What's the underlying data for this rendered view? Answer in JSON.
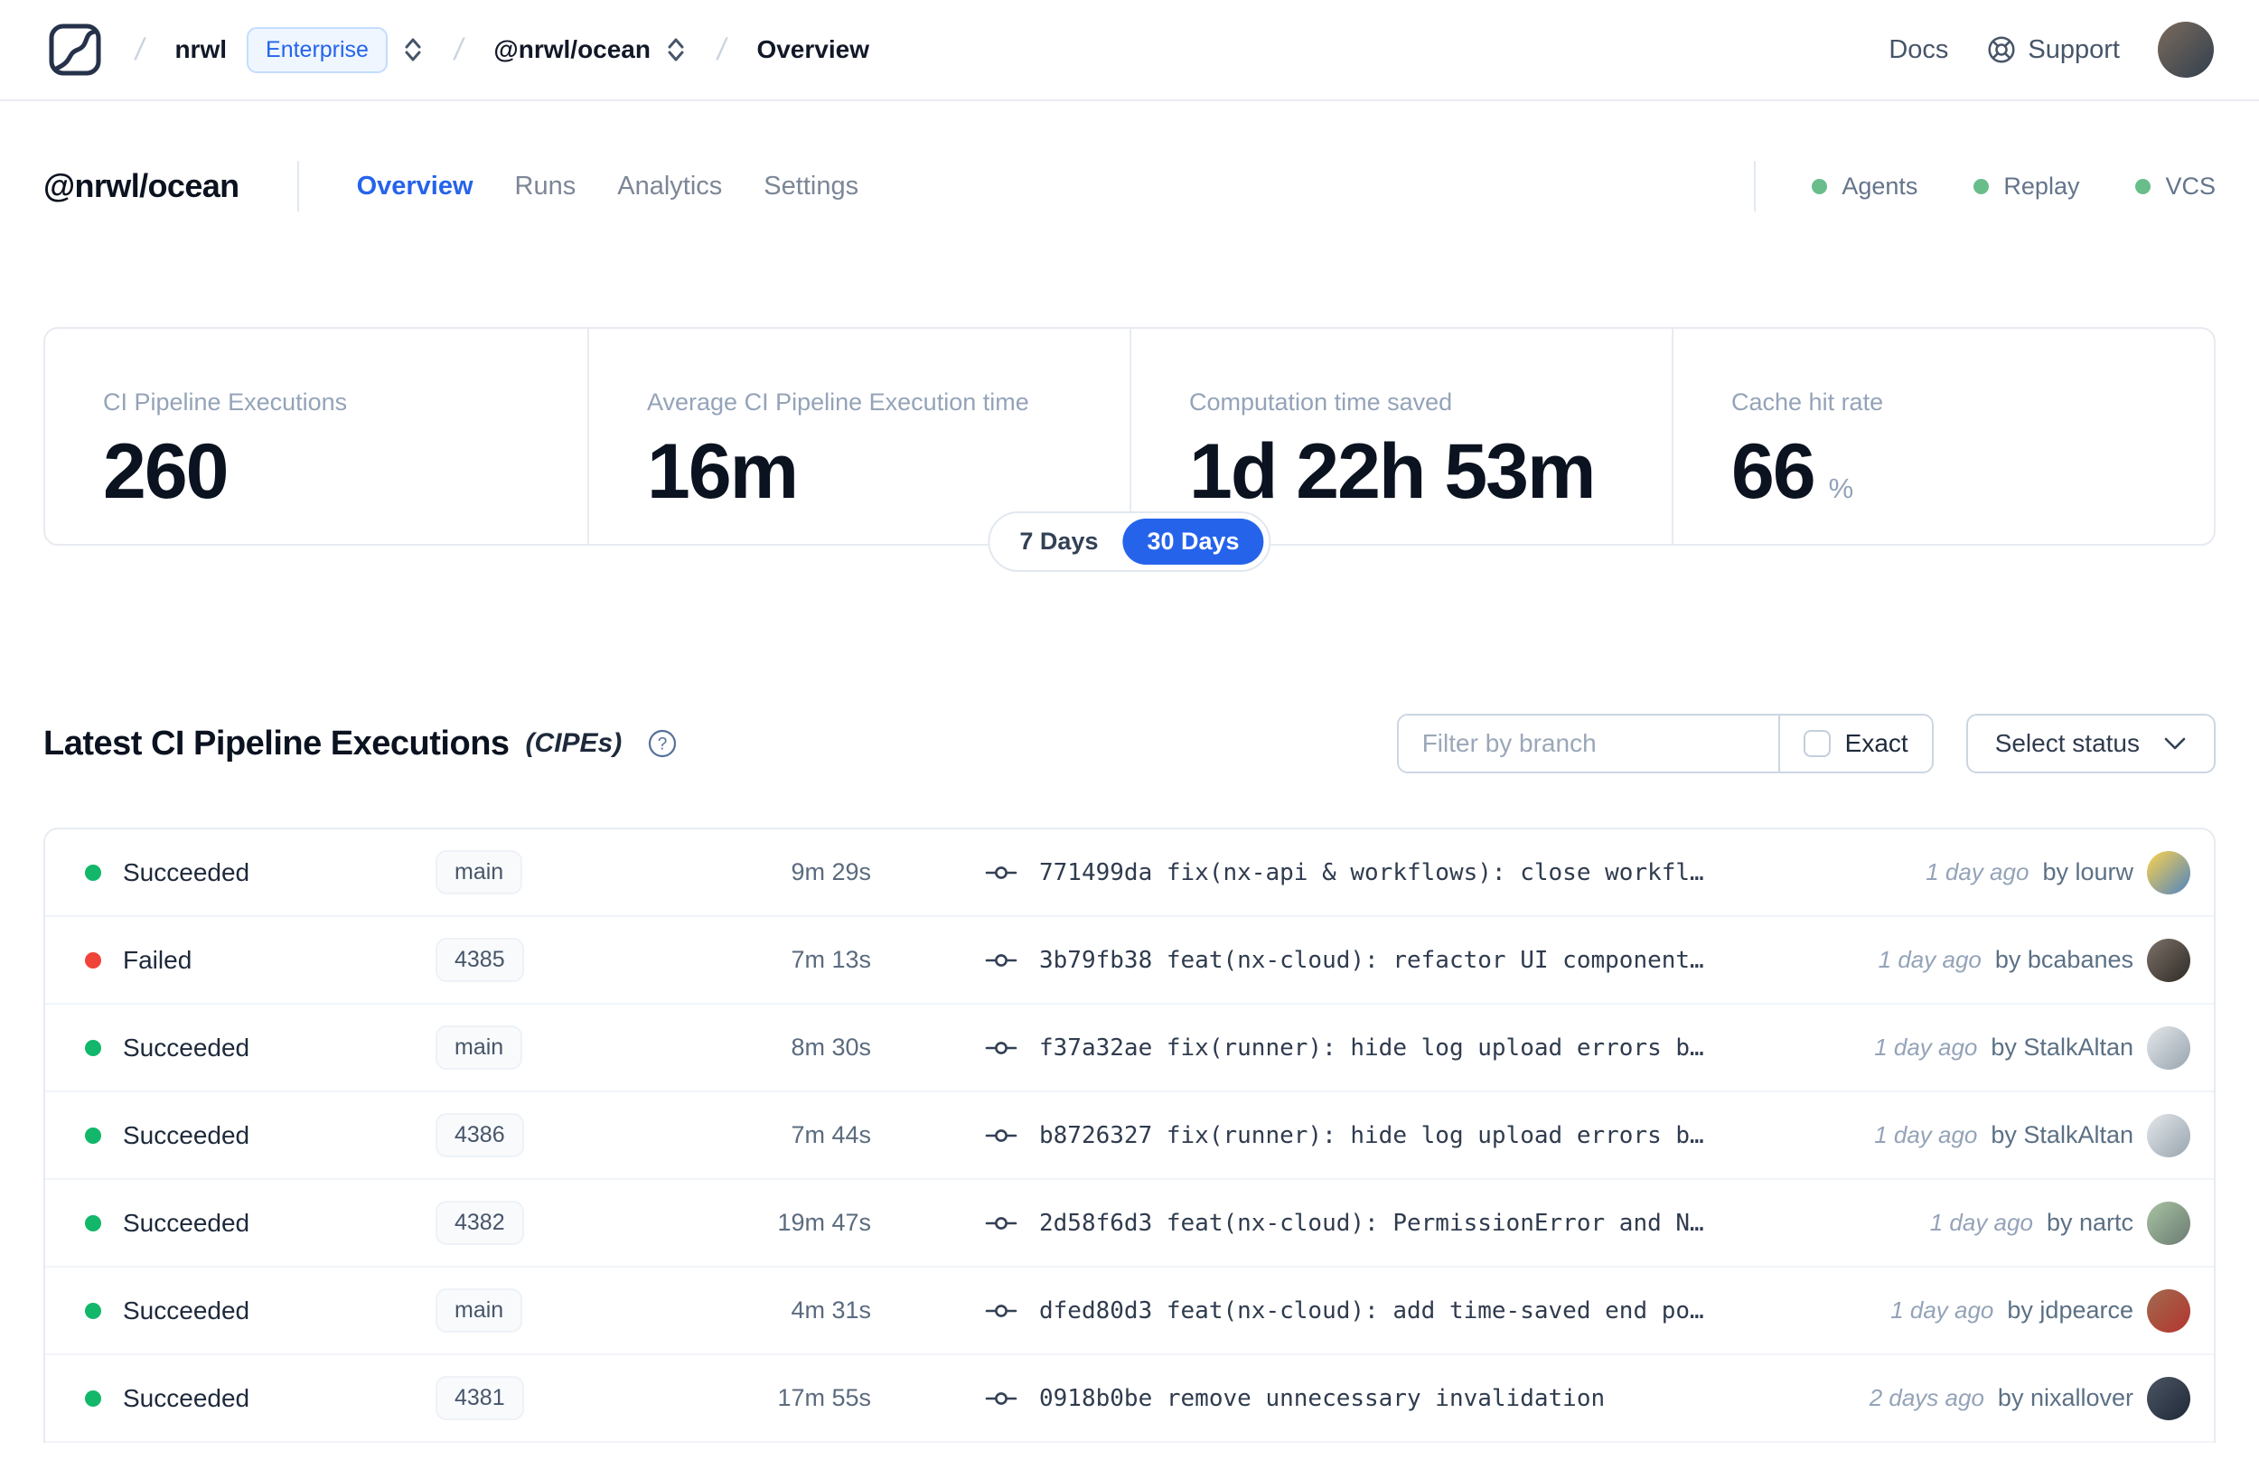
{
  "colors": {
    "accent": "#2563eb",
    "succeeded": "#12b76a",
    "failed": "#f04438",
    "feature_green": "#68bd8b"
  },
  "header": {
    "separator": "/",
    "org": "nrwl",
    "plan_badge": "Enterprise",
    "workspace": "@nrwl/ocean",
    "page": "Overview",
    "docs": "Docs",
    "support": "Support",
    "avatar_colors": [
      "#7b6a5c",
      "#32404e"
    ]
  },
  "workspace": {
    "title": "@nrwl/ocean",
    "tabs": [
      {
        "label": "Overview",
        "active": true
      },
      {
        "label": "Runs",
        "active": false
      },
      {
        "label": "Analytics",
        "active": false
      },
      {
        "label": "Settings",
        "active": false
      }
    ],
    "features": [
      {
        "label": "Agents"
      },
      {
        "label": "Replay"
      },
      {
        "label": "VCS"
      }
    ]
  },
  "stats": {
    "cards": [
      {
        "label": "CI Pipeline Executions",
        "value": "260",
        "suffix": ""
      },
      {
        "label": "Average CI Pipeline Execution time",
        "value": "16m",
        "suffix": ""
      },
      {
        "label": "Computation time saved",
        "value": "1d 22h 53m",
        "suffix": ""
      },
      {
        "label": "Cache hit rate",
        "value": "66",
        "suffix": "%"
      }
    ],
    "range": {
      "options": [
        "7 Days",
        "30 Days"
      ],
      "selected": "30 Days"
    }
  },
  "cipes": {
    "title": "Latest CI Pipeline Executions",
    "title_suffix": "(CIPEs)",
    "filter": {
      "placeholder": "Filter by branch",
      "exact_label": "Exact",
      "status_label": "Select status"
    },
    "rows": [
      {
        "status": "Succeeded",
        "status_color": "#12b76a",
        "branch": "main",
        "duration": "9m 29s",
        "commit": "771499da fix(nx-api & workflows): close workfl…",
        "time": "1 day ago",
        "author": "by lourw",
        "avatar_colors": [
          "#fcd34d",
          "#4f83c2"
        ]
      },
      {
        "status": "Failed",
        "status_color": "#f04438",
        "branch": "4385",
        "duration": "7m 13s",
        "commit": "3b79fb38 feat(nx-cloud): refactor UI component…",
        "time": "1 day ago",
        "author": "by bcabanes",
        "avatar_colors": [
          "#7c7268",
          "#2f2a26"
        ]
      },
      {
        "status": "Succeeded",
        "status_color": "#12b76a",
        "branch": "main",
        "duration": "8m 30s",
        "commit": "f37a32ae fix(runner): hide log upload errors b…",
        "time": "1 day ago",
        "author": "by StalkAltan",
        "avatar_colors": [
          "#e3e7ea",
          "#98a4ae"
        ]
      },
      {
        "status": "Succeeded",
        "status_color": "#12b76a",
        "branch": "4386",
        "duration": "7m 44s",
        "commit": "b8726327 fix(runner): hide log upload errors b…",
        "time": "1 day ago",
        "author": "by StalkAltan",
        "avatar_colors": [
          "#e3e7ea",
          "#98a4ae"
        ]
      },
      {
        "status": "Succeeded",
        "status_color": "#12b76a",
        "branch": "4382",
        "duration": "19m 47s",
        "commit": "2d58f6d3 feat(nx-cloud): PermissionError and N…",
        "time": "1 day ago",
        "author": "by nartc",
        "avatar_colors": [
          "#a8c4a2",
          "#6b7a72"
        ]
      },
      {
        "status": "Succeeded",
        "status_color": "#12b76a",
        "branch": "main",
        "duration": "4m 31s",
        "commit": "dfed80d3 feat(nx-cloud): add time-saved end po…",
        "time": "1 day ago",
        "author": "by jdpearce",
        "avatar_colors": [
          "#a16b4f",
          "#b3342e"
        ]
      },
      {
        "status": "Succeeded",
        "status_color": "#12b76a",
        "branch": "4381",
        "duration": "17m 55s",
        "commit": "0918b0be remove unnecessary invalidation",
        "time": "2 days ago",
        "author": "by nixallover",
        "avatar_colors": [
          "#4b5563",
          "#1f2937"
        ]
      }
    ]
  }
}
